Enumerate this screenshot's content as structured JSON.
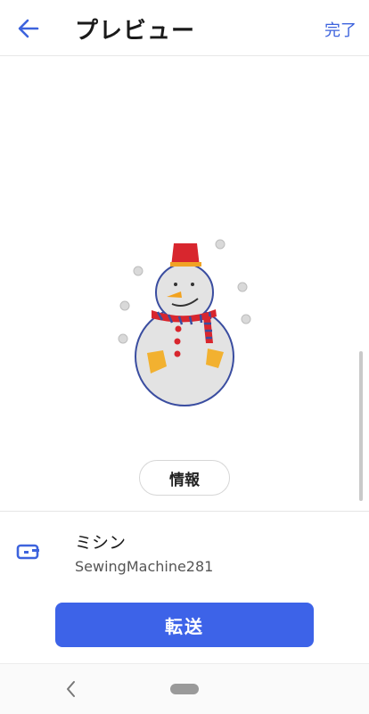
{
  "header": {
    "title": "プレビュー",
    "done_label": "完了",
    "back_icon": "arrow-left-icon"
  },
  "preview": {
    "image": "snowman-embroidery",
    "info_label": "情報"
  },
  "machine": {
    "icon": "sewing-machine-icon",
    "label": "ミシン",
    "name": "SewingMachine281"
  },
  "actions": {
    "transfer_label": "転送"
  },
  "colors": {
    "accent": "#3d63e8",
    "link": "#3d63dd"
  },
  "navbar": {
    "back_icon": "nav-back-icon",
    "home_icon": "home-pill-icon"
  }
}
